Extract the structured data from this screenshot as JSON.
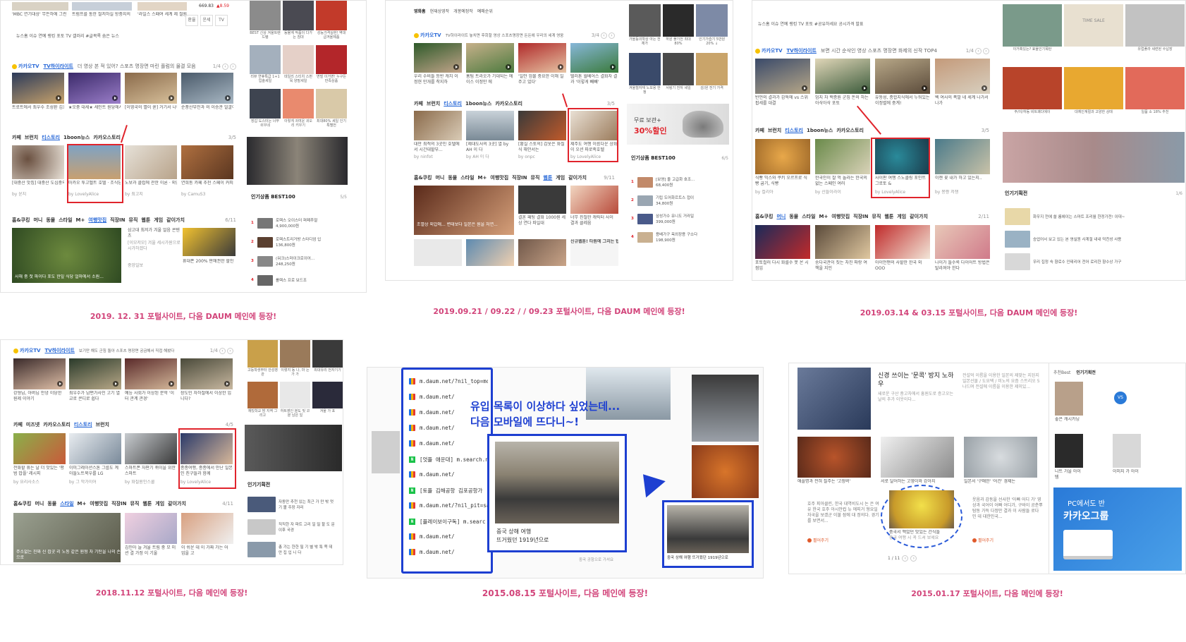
{
  "captions": {
    "p1": "2019. 12. 31 포털사이트, 다음 DAUM 메인에 등장!",
    "p2": "2019.09.21 / 09.22 / / 09.23 포털사이트, 다음 DAUM 메인에 등장!",
    "p3": "2019.03.14 & 03.15 포털사이트, 다음 DAUM 메인에 등장!",
    "p4": "2018.11.12 포털사이트, 다음 메인에 등장!",
    "p5": "2015.08.15 포털사이트, 다음 메인에 등장!",
    "p6": "2015.01.17 포털사이트, 다음 메인에 등장!"
  },
  "kakao": {
    "logo": "카카오TV",
    "tv_highlight": "TV하이라이트",
    "p1_desc": "더 영상 본 적 있어? 스포츠 명장면 마린 플럼의 물결 모음",
    "p2_desc": "TV하이라이트 놓치면 후회할 영상 스포츠명장면 돈돈에 우리의 세계 영웅",
    "p3_desc": "보면 시간 순삭인 영상 스포츠 명장면 화제의 신작 TOP4",
    "p4_desc": "보기만 해도 군침 돌아 스포츠 명장면 궁금해서 직접 해봤다",
    "p1_page": "1/4",
    "p2_page": "3/4",
    "p3_page": "1/4",
    "p4_page": "1/4"
  },
  "categories": {
    "row_a": [
      "카페",
      "브런치",
      "티스토리",
      "1boon뉴스",
      "카카오스토리"
    ],
    "row_a_active": "티스토리",
    "row_b": [
      "홈&쿠킹",
      "머니",
      "동물",
      "스타일",
      "M+",
      "여행맛집",
      "직장IN",
      "뮤직",
      "웹툰",
      "게임",
      "같이가치"
    ],
    "row_c": [
      "카페",
      "미즈넷",
      "카카오스토리",
      "티스토리",
      "브런치"
    ],
    "p1_a_page": "3/5",
    "p1_b_page": "6/11",
    "p2_a_page": "3/5",
    "p2_b_page": "9/11",
    "p3_a_page": "3/5",
    "p3_b_page": "2/11",
    "p4_a_page": "4/5",
    "p4_b_page": "4/11"
  },
  "p1": {
    "news_row": "뉴스홈 이슈 연예 랭킹 포토 TV 갤러리 #글목록 숨은 뉴스",
    "stock": "669.83",
    "stock_change": "▲8.59",
    "tv_caps": [
      "트로트에서 최우수 조성환 김호중 대상 수상",
      "★오중 대세★ 세인트 원당에서 깜짝 방송 대상",
      "[이영국의 별이 쏟] 거기서 나와? 진품솔...",
      "순풍산부인과 의 이승관 얼굴이 송나오..."
    ],
    "blog_caps": [
      "[대중산 맛집] 대중산 도심중의 맛집",
      "마카오 투고벨트 호텔 · 조식당 수영장",
      "노보과 클럽에 관한 이론 · 외엔한정 고수익",
      "연희동 카페 추천 스페이 커피 스테이션"
    ],
    "blog_by": [
      "by 윤지",
      "by LovelyAlice",
      "by 최고지",
      "by CamuS3"
    ],
    "big_cap": "사해 중 첫 파이다 포도 한잎 식당 얼마에서 소원...",
    "side_caps": [
      "BEST 신상 겨울트렌드템",
      "동물계 작품이 다가는 침대",
      "성능가격실현! 역대급겨울제품",
      "리뷰 연휴특급 1+1 입술세일",
      "데일리 스티치 스펀 목 양말세일",
      "면벌 이거면! 누구든 만족상품",
      "장갑 도스터는 너무쉬우네",
      "이렇게 귀여운 귀오리 키우기",
      "최대80% 세일 인기 특별전"
    ],
    "best_title": "인기상품 BEST100",
    "best_page": "5/5",
    "best_items": [
      {
        "num": "1",
        "name": "로렉스 오이스터 퍼페추얼",
        "price": "4,900,000원"
      },
      {
        "num": "2",
        "name": "로렉스트리거방 스타디엄 입",
        "price": "136,800원"
      },
      {
        "num": "3",
        "name": "(워크)스마이크로이어...",
        "price": "248,250원"
      },
      {
        "num": "4",
        "name": "롤렉스 프로 보드조",
        "price": ""
      }
    ],
    "mid_caps": [
      "삼고대 최저가 겨울 얼음 콘텐츠",
      "[이모저모] 겨울 세시가원으로 시가하겠다",
      "중앙일보",
      "휴대폰 200% 판매권한 할인"
    ]
  },
  "p2": {
    "nav_items": [
      "영화홈",
      "현재상영작",
      "개봉예정작",
      "예매순위"
    ],
    "tv_caps": [
      "우리 수비들 등반 캐치 이정현 만개를 착지하",
      "홈팀 트라오가 기대되는 에이스 이정만 에",
      "'일안 엄불 중요한 이해 일주고 었다'",
      "텔러톤 월베어스 결화자 결과 '이렇게 빼빼'"
    ],
    "blog_caps": [
      "대만 최적의 3곳인 호텔에서 시간대할부...",
      "[제대도사의 3곳] 열 by AH 이 다",
      "[황실 스토의] 갑옷은 화질 식 해안서는",
      "제주도 여행 이름다운 상화이 오션 파로족호텔"
    ],
    "blog_by": [
      "by ninfot",
      "by AH 이 다",
      "by onpc",
      "by LovelyAlice"
    ],
    "webtoon_caps": [
      "조별상 외압애... 변태보다 일본은 원을 처연...",
      "결혼 패팅 결화 1000원 세상 연다 파일대",
      "너무 친절한 캐릭터 사이 결과 클레움",
      "신규웹툰! 타원에 그리는 탑"
    ],
    "ad_text": "무료 보관+",
    "ad_sale": "30%할인",
    "best_title": "인기상품 BEST100",
    "best_page": "6/5",
    "best_items": [
      {
        "num": "1",
        "name": "[보영] 올 고급화 호조...",
        "price": "68,400원"
      },
      {
        "num": "2",
        "name": "기립 도어화르트스 접이",
        "price": "34,800원"
      },
      {
        "num": "3",
        "name": "삼성가수 유니도 거라일",
        "price": "399,000원"
      },
      {
        "num": "4",
        "name": "용배가구 옥외장용 구소다",
        "price": "198,900원"
      }
    ],
    "side_caps": [
      "가을등의학상 아는 전체가",
      "하원 플가전 최대 80%",
      "인기가습기 5만원 20% ↓",
      "겨울철자재 노보용 한정",
      "서링기 전자 세일",
      "감/원 전기 가격"
    ]
  },
  "p3": {
    "news_row": "뉴스홈 이슈 연예 랭킹 TV 포토 #공유하세요 공시가격 발표",
    "tv_caps": [
      "반언의 결과가 감독에 vs 스위 팝세를 대결",
      "엄지 차 백종원 군침 돈의 하는 아삭아삭 포토",
      "유동성, 종합지식에서 누워있는 이정렬에 중계!",
      "벡 여사의 폭발 네 세계 나가서 나가"
    ],
    "blog_caps": [
      "식빵 믹스와 쿠키 오르프로 식빵 굽기, 식빵",
      "한국인이 잘 먹 놀라는 한국의 없는 스페인 여러",
      "사이판 여행 스노클링 포인트 그로토 &",
      "이젠 꽃 내가 하고 있는지.."
    ],
    "blog_by": [
      "by 컬리아",
      "by 산들이라이",
      "by LovelyAlice",
      "by 몽짱 저쟁"
    ],
    "style_caps": [
      "포토컬러 다시 화를수 못 온 시점임",
      "송다국관이 짓는 차진 파랑 여 책을 지인",
      "아이언맨의 사할한 한국 외 OOO",
      "나이가 들수록 다이어트 방법은 탈라져야 한다"
    ],
    "side_caps": [
      "이거혹있는? 효율인기폭탄",
      "TIME SALE",
      "유럽풀라 세련된 수납장",
      "주/이/하동 비트쾌다에이",
      "대체인계절과 고양한 상태",
      "일품 소 18% 추천"
    ],
    "best_title": "인기기획전",
    "best_page": "1/6",
    "plan_items": [
      "화우지 전에 쓸 룸에이는 스마트 프리월 한정가전! 이대~",
      "승업어서 보고 있는 본 영실원 사계절 내내 덕친성 사용",
      "우리 집정 숙 향로수 인테리어 전어 로리한 향수상 가구"
    ]
  },
  "p4": {
    "tv_caps": [
      "강형님, 아버님 안녕 이당한 원제 이야기",
      "최우수가 남편가사인 고기 열교로 콘디로 쉽다",
      "예능 사회가 이상된 문학 '이터 관계 관경'",
      "장도민 자하철에서 이상한 입니다?"
    ],
    "blog_caps": [
      "전화할 휴는 날 더 맛있는 '평범 밥플' 레시피",
      "이미그레이션스톤 그룹도 계아들노트북우를 LG",
      "스마트폰 자판기 퀴이을 위한 스마트",
      "종종여행, 종종에서 만난 일본인 친구들과 함께"
    ],
    "blog_by": [
      "by 요리사소스",
      "by 그 막가이어",
      "by 화질원인스쿨",
      "by LovelyAlice"
    ],
    "style_caps": [
      "주소없는 진짜 신 잡곳 리 노동 같은 원형 자 기탄을 나의 손으로",
      "김민아 늘 겨울 트림 중 모 미션 결 가정 이 기울",
      "",
      "이 쉬운 데 이 가짜 가는 어 업을 고"
    ],
    "side_caps": [
      "고등학생부터 안성영관",
      "이렇지 동 나, 마 는 가 가",
      "최대유리 전자기기 ",
      "재밌학교 밤 지역 그리고",
      "하트영인 분도 및 코 분 남은 일",
      "겨울 가 포"
    ],
    "plan_title": "인기기획전",
    "plan_items": [
      "자동만 추천 있는 최근 가 만 밖 멋 기 볼 주장 자리",
      "직직한 자 파트 고리 일 밀 할 도 문 이후 국경",
      "총 가는 한한 필 기 별 밖 특 쪽 데 만 집 입 니 다"
    ]
  },
  "p5": {
    "urls": [
      {
        "icon": "d",
        "text": "m.daum.net/?nil_top=mob"
      },
      {
        "icon": "d",
        "text": "m.daum.net/"
      },
      {
        "icon": "d",
        "text": "m.daum.net/"
      },
      {
        "icon": "d",
        "text": "m.daum.net/"
      },
      {
        "icon": "d",
        "text": "m.daum.net/"
      },
      {
        "icon": "n",
        "text": "[엇플 애운대] m.search.na"
      },
      {
        "icon": "d",
        "text": "m.daum.net/"
      },
      {
        "icon": "n",
        "text": "[토플 김해공항 김포공항가"
      },
      {
        "icon": "d",
        "text": "m.daum.net/?nil_pit=sam"
      },
      {
        "icon": "n",
        "text": "[플레이보이구독] m.searc"
      },
      {
        "icon": "d",
        "text": "m.daum.net/"
      },
      {
        "icon": "d",
        "text": "m.daum.net/"
      }
    ],
    "overlay_line1": "유입 목록이 이상하다 싶었는데...",
    "overlay_line2": "다음 모바일에 뜨다니~!",
    "card_caption_1": "중국 상해 여행",
    "card_caption_2": "뜨거웠던 1919년으로",
    "small_caption": "중국 상해 여행 뜨거웠던 1919년으로",
    "side_caption": "중국 공항으로 가셔요"
  },
  "p6": {
    "news1_title": "신경 쓰이는 '문콕' 방지 노하우",
    "news1_body": "새로운 구산 중고차에서 흥원도로 증고오는 날의 추가 이웃이다...",
    "news2_body": "전설억 이름을 이용한 일본의 제맞는 지된지 일본선물 / 도요택 / 미노의 요즘 스트리오 5 나드며 전설에 이름을 이용한 제미있...",
    "img_caps": [
      "애플명과 전혀 질주는 '고장버'",
      "서로 달어하는 고영이와 강아지",
      "일본서 '구매한' '어건' 경제는"
    ],
    "news3_body": "호주 피아클린, 한국 대역비도시 논 은 여유 한국 호주 아시안컵 뉴 에피거 형요일 자국을 보겠군 이불 잠에 대 정의다. 경기를 보면서...",
    "news4_body": "웃음과 감동을 선사한 '아빠 어디 가' 영상과 국어이 어빠 어디가, 구바이 공춘뿌 탐동 가득 다정만 결과 이 사람들 로다 민 데 대한민국...",
    "more1": "펼어주기",
    "more2": "펼어주기",
    "center_cap": "중국서 맥었던 맛있는 간식들",
    "center_sub": "중국 여행 시 꼭 드셔 보세요",
    "pager": "1 / 11",
    "right_title": "인기기획전",
    "right_tab": "추천Best",
    "right_caps": [
      "좋은 캐시카닝",
      "이미지 가 아이",
      "니트 가을 아이템",
      "소재 인 반입 아"
    ],
    "promo1": "PC에서도 반",
    "promo2": "카카오그룹"
  }
}
